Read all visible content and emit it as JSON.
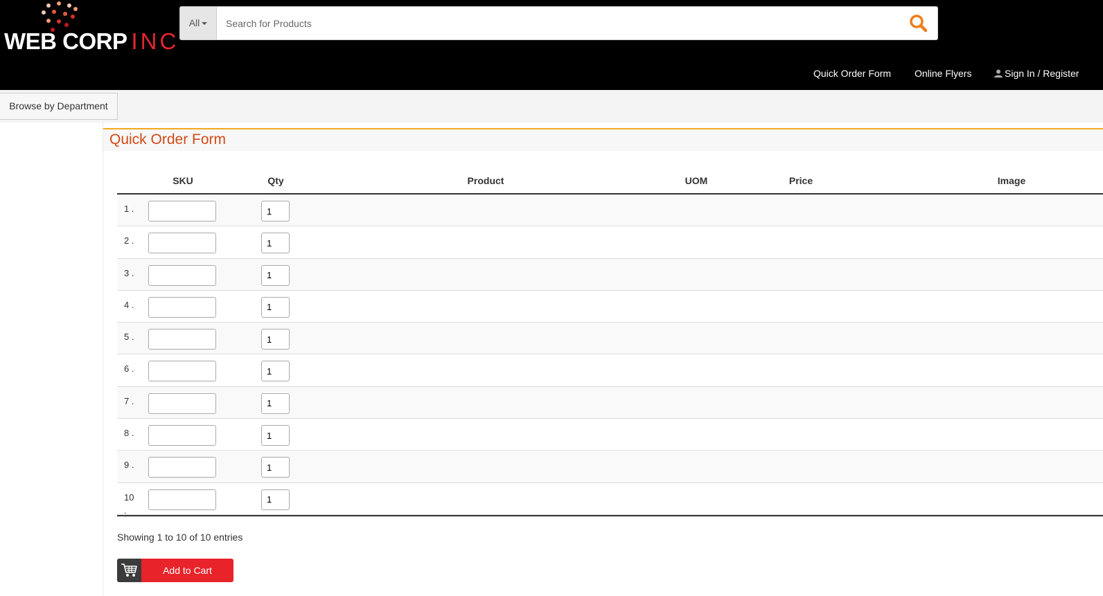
{
  "brand": {
    "name_main": "WEB CORP",
    "name_suffix": "INC"
  },
  "search": {
    "category": "All",
    "placeholder": "Search for Products"
  },
  "nav": {
    "quick_order": "Quick Order Form",
    "flyers": "Online Flyers",
    "signin": "Sign In / Register"
  },
  "department_button": "Browse by Department",
  "page_title": "Quick Order Form",
  "table": {
    "headers": {
      "sku": "SKU",
      "qty": "Qty",
      "product": "Product",
      "uom": "UOM",
      "price": "Price",
      "image": "Image"
    },
    "rows": [
      {
        "num": "1 .",
        "sku": "",
        "qty": "1"
      },
      {
        "num": "2 .",
        "sku": "",
        "qty": "1"
      },
      {
        "num": "3 .",
        "sku": "",
        "qty": "1"
      },
      {
        "num": "4 .",
        "sku": "",
        "qty": "1"
      },
      {
        "num": "5 .",
        "sku": "",
        "qty": "1"
      },
      {
        "num": "6 .",
        "sku": "",
        "qty": "1"
      },
      {
        "num": "7 .",
        "sku": "",
        "qty": "1"
      },
      {
        "num": "8 .",
        "sku": "",
        "qty": "1"
      },
      {
        "num": "9 .",
        "sku": "",
        "qty": "1"
      },
      {
        "num": "10 .",
        "sku": "",
        "qty": "1"
      }
    ]
  },
  "entries_info": "Showing 1 to 10 of 10 entries",
  "add_to_cart": "Add to Cart",
  "colors": {
    "accent_orange": "#f3a81d",
    "title_orange": "#d24a16",
    "cart_red": "#e8232a",
    "search_icon": "#f07d1a"
  }
}
